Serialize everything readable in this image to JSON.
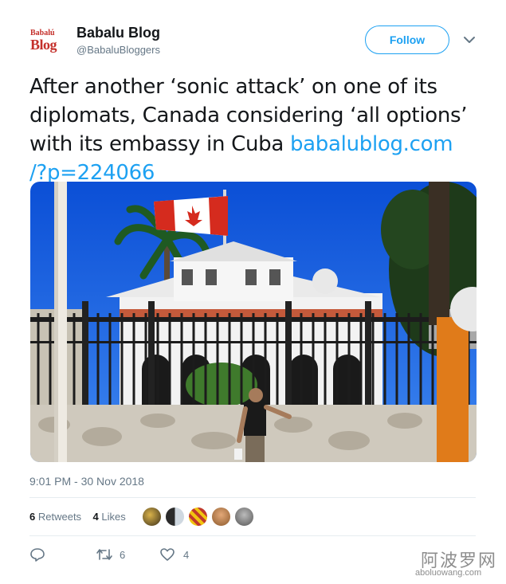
{
  "author": {
    "display_name": "Babalu Blog",
    "handle": "@BabaluBloggers",
    "avatar_line1": "Babalú",
    "avatar_line2": "Blog",
    "avatar_icon": "babalu-blog-logo"
  },
  "follow_label": "Follow",
  "tweet": {
    "text": "After another ‘sonic attack’ on one of its diplomats, Canada considering ‘all options’ with its embassy in Cuba ",
    "link": "babalublog.com\n/?p=224066",
    "timestamp": "9:01 PM - 30 Nov 2018"
  },
  "photo_icon": "canada-embassy-havana-photo",
  "stats": {
    "retweets_count": "6",
    "retweets_label": "Retweets",
    "likes_count": "4",
    "likes_label": "Likes"
  },
  "actions": {
    "reply_icon": "reply-icon",
    "retweet_icon": "retweet-icon",
    "retweet_count": "6",
    "like_icon": "heart-icon",
    "like_count": "4"
  },
  "watermark": {
    "cn": "阿波罗网",
    "url": "aboluowang.com"
  },
  "colors": {
    "accent": "#1da1f2",
    "brand_red": "#c4302b",
    "muted": "#657786"
  }
}
